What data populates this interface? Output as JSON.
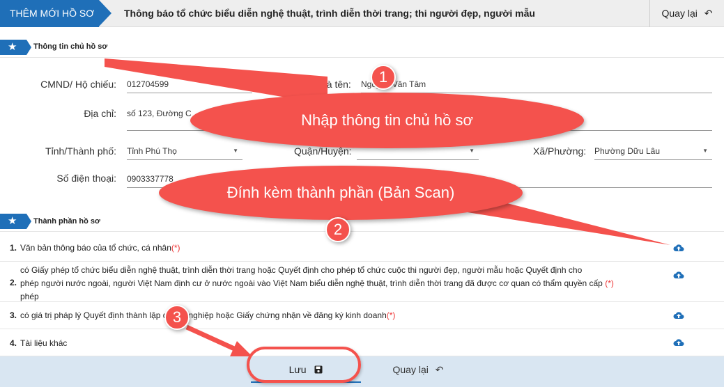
{
  "header": {
    "tag": "THÊM MỚI HỒ SƠ",
    "title": "Thông báo tổ chức biểu diễn nghệ thuật, trình diễn thời trang; thi người đẹp, người mẫu",
    "back": "Quay lại"
  },
  "owner_section": {
    "title": "Thông tin chủ hồ sơ"
  },
  "form": {
    "id_label": "CMND/ Hộ chiếu:",
    "id_value": "012704599",
    "name_label": "Họ và tên:",
    "name_value": "Nguyễn Văn Tâm",
    "address_label": "Địa chỉ:",
    "address_value": "số 123, Đường C",
    "province_label": "Tỉnh/Thành phố:",
    "province_value": "Tỉnh Phú Thọ",
    "district_label": "Quận/Huyện:",
    "ward_label": "Xã/Phường:",
    "ward_value": "Phường Dữu Lâu",
    "phone_label": "Số điện thoại:",
    "phone_value": "0903337778"
  },
  "docs_section": {
    "title": "Thành phần hồ sơ"
  },
  "documents": [
    {
      "num": "1.",
      "text": "Văn bản thông báo của tổ chức, cá nhân",
      "req": "(*)"
    },
    {
      "num": "2.",
      "line1": "có Giấy phép tổ chức biểu diễn nghệ thuật, trình diễn thời trang hoặc Quyết định cho phép tổ chức cuộc thi người đẹp, người mẫu hoặc Quyết định cho",
      "line2": "phép người nước ngoài, người Việt Nam định cư ở nước ngoài vào Việt Nam biểu diễn nghệ thuật, trình diễn thời trang đã được cơ quan có thẩm quyền cấp",
      "line3": "phép",
      "req": "(*)"
    },
    {
      "num": "3.",
      "text": "có giá trị pháp lý Quyết định thành lập doanh nghiệp hoặc Giấy chứng nhận về đăng ký kinh doanh",
      "req": "(*)"
    },
    {
      "num": "4.",
      "text": "Tài liệu khác"
    }
  ],
  "footer": {
    "save": "Lưu",
    "back": "Quay lại"
  },
  "annotations": {
    "step1": "1",
    "step1_text": "Nhập thông tin chủ hồ sơ",
    "step2": "2",
    "step2_text": "Đính kèm thành phần (Bản Scan)",
    "step3": "3"
  },
  "colors": {
    "primary": "#1f6fb8",
    "callout": "#f4524d",
    "footer": "#d9e6f2",
    "required": "#e33333"
  },
  "icons": [
    "star-icon",
    "back-arrow-icon",
    "upload-cloud-icon",
    "save-disk-icon",
    "chevron-down-icon"
  ]
}
